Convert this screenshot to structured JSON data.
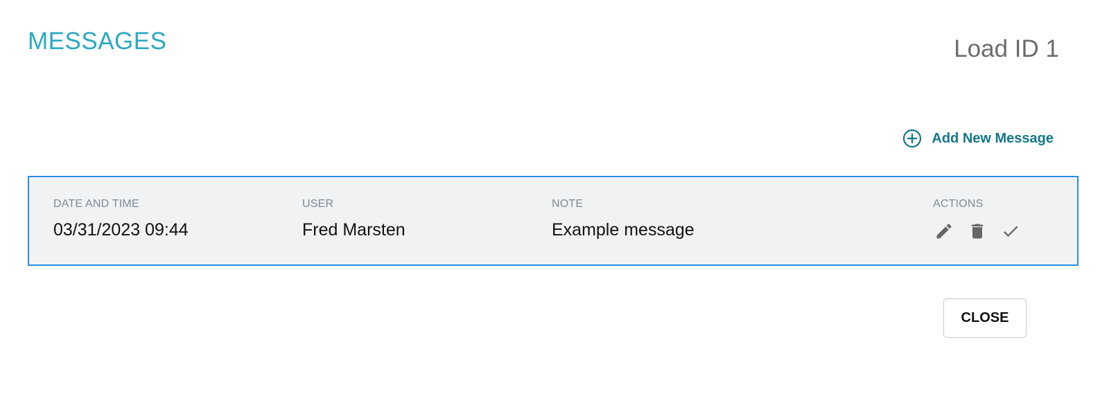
{
  "header": {
    "title": "MESSAGES",
    "load_id": "Load ID 1"
  },
  "toolbar": {
    "add_label": "Add New Message",
    "add_icon": "plus-circle-icon"
  },
  "table": {
    "columns": [
      "DATE AND TIME",
      "USER",
      "NOTE",
      "ACTIONS"
    ],
    "rows": [
      {
        "datetime": "03/31/2023 09:44",
        "user": "Fred Marsten",
        "note": "Example message",
        "actions": [
          "edit-icon",
          "delete-icon",
          "check-icon"
        ]
      }
    ]
  },
  "footer": {
    "close_label": "CLOSE"
  },
  "colors": {
    "title": "#2aa9c2",
    "accent": "#13768a",
    "selected_border": "#2a8de4",
    "row_background": "#f0f2f4"
  }
}
